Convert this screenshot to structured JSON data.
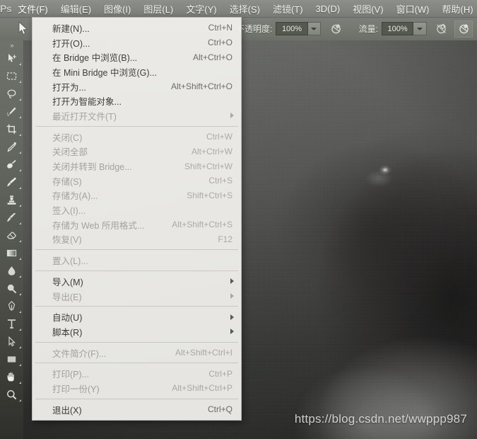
{
  "app": {
    "name": "Adobe Photoshop",
    "logo_text": "Ps"
  },
  "menubar": {
    "items": [
      {
        "label": "文件(F)",
        "name": "menu-file",
        "active": true
      },
      {
        "label": "编辑(E)",
        "name": "menu-edit",
        "active": false
      },
      {
        "label": "图像(I)",
        "name": "menu-image",
        "active": false
      },
      {
        "label": "图层(L)",
        "name": "menu-layer",
        "active": false
      },
      {
        "label": "文字(Y)",
        "name": "menu-type",
        "active": false
      },
      {
        "label": "选择(S)",
        "name": "menu-select",
        "active": false
      },
      {
        "label": "滤镜(T)",
        "name": "menu-filter",
        "active": false
      },
      {
        "label": "3D(D)",
        "name": "menu-3d",
        "active": false
      },
      {
        "label": "视图(V)",
        "name": "menu-view",
        "active": false
      },
      {
        "label": "窗口(W)",
        "name": "menu-window",
        "active": false
      },
      {
        "label": "帮助(H)",
        "name": "menu-help",
        "active": false
      }
    ]
  },
  "options_bar": {
    "opacity_label": "不透明度:",
    "opacity_value": "100%",
    "flow_label": "流量:",
    "flow_value": "100%",
    "airbrush_icon": "airbrush-icon",
    "pressure_opacity_icon": "pressure-opacity-icon",
    "pressure_size_icon": "pressure-size-icon"
  },
  "toolbar": {
    "collapse_glyph": "»",
    "tools": [
      {
        "name": "move-tool",
        "icon": "move-icon"
      },
      {
        "name": "marquee-tool",
        "icon": "rectangular-marquee-icon"
      },
      {
        "name": "lasso-tool",
        "icon": "lasso-icon"
      },
      {
        "name": "quick-selection-tool",
        "icon": "quick-selection-icon"
      },
      {
        "name": "crop-tool",
        "icon": "crop-icon"
      },
      {
        "name": "eyedropper-tool",
        "icon": "eyedropper-icon"
      },
      {
        "name": "healing-brush-tool",
        "icon": "healing-brush-icon"
      },
      {
        "name": "brush-tool",
        "icon": "brush-icon"
      },
      {
        "name": "clone-stamp-tool",
        "icon": "clone-stamp-icon"
      },
      {
        "name": "history-brush-tool",
        "icon": "history-brush-icon"
      },
      {
        "name": "eraser-tool",
        "icon": "eraser-icon"
      },
      {
        "name": "gradient-tool",
        "icon": "gradient-icon"
      },
      {
        "name": "blur-tool",
        "icon": "blur-droplet-icon"
      },
      {
        "name": "dodge-tool",
        "icon": "dodge-icon"
      },
      {
        "name": "pen-tool",
        "icon": "pen-icon"
      },
      {
        "name": "type-tool",
        "icon": "type-icon"
      },
      {
        "name": "path-selection-tool",
        "icon": "path-selection-icon"
      },
      {
        "name": "rectangle-tool",
        "icon": "rectangle-shape-icon"
      },
      {
        "name": "hand-tool",
        "icon": "hand-icon"
      },
      {
        "name": "zoom-tool",
        "icon": "magnifier-icon"
      }
    ]
  },
  "file_menu": {
    "title": "文件(F)",
    "groups": [
      {
        "items": [
          {
            "label": "新建(N)...",
            "accel": "Ctrl+N",
            "disabled": false,
            "submenu": false,
            "name": "file-new"
          },
          {
            "label": "打开(O)...",
            "accel": "Ctrl+O",
            "disabled": false,
            "submenu": false,
            "name": "file-open"
          },
          {
            "label": "在 Bridge 中浏览(B)...",
            "accel": "Alt+Ctrl+O",
            "disabled": false,
            "submenu": false,
            "name": "file-browse-bridge"
          },
          {
            "label": "在 Mini Bridge 中浏览(G)...",
            "accel": "",
            "disabled": false,
            "submenu": false,
            "name": "file-browse-mini-bridge"
          },
          {
            "label": "打开为...",
            "accel": "Alt+Shift+Ctrl+O",
            "disabled": false,
            "submenu": false,
            "name": "file-open-as"
          },
          {
            "label": "打开为智能对象...",
            "accel": "",
            "disabled": false,
            "submenu": false,
            "name": "file-open-as-smart-object"
          },
          {
            "label": "最近打开文件(T)",
            "accel": "",
            "disabled": true,
            "submenu": true,
            "name": "file-open-recent"
          }
        ]
      },
      {
        "items": [
          {
            "label": "关闭(C)",
            "accel": "Ctrl+W",
            "disabled": true,
            "submenu": false,
            "name": "file-close"
          },
          {
            "label": "关闭全部",
            "accel": "Alt+Ctrl+W",
            "disabled": true,
            "submenu": false,
            "name": "file-close-all"
          },
          {
            "label": "关闭并转到 Bridge...",
            "accel": "Shift+Ctrl+W",
            "disabled": true,
            "submenu": false,
            "name": "file-close-go-to-bridge"
          },
          {
            "label": "存储(S)",
            "accel": "Ctrl+S",
            "disabled": true,
            "submenu": false,
            "name": "file-save"
          },
          {
            "label": "存储为(A)...",
            "accel": "Shift+Ctrl+S",
            "disabled": true,
            "submenu": false,
            "name": "file-save-as"
          },
          {
            "label": "签入(I)...",
            "accel": "",
            "disabled": true,
            "submenu": false,
            "name": "file-check-in"
          },
          {
            "label": "存储为 Web 所用格式...",
            "accel": "Alt+Shift+Ctrl+S",
            "disabled": true,
            "submenu": false,
            "name": "file-save-for-web"
          },
          {
            "label": "恢复(V)",
            "accel": "F12",
            "disabled": true,
            "submenu": false,
            "name": "file-revert"
          }
        ]
      },
      {
        "items": [
          {
            "label": "置入(L)...",
            "accel": "",
            "disabled": true,
            "submenu": false,
            "name": "file-place"
          }
        ]
      },
      {
        "items": [
          {
            "label": "导入(M)",
            "accel": "",
            "disabled": false,
            "submenu": true,
            "name": "file-import"
          },
          {
            "label": "导出(E)",
            "accel": "",
            "disabled": true,
            "submenu": true,
            "name": "file-export"
          }
        ]
      },
      {
        "items": [
          {
            "label": "自动(U)",
            "accel": "",
            "disabled": false,
            "submenu": true,
            "name": "file-automate"
          },
          {
            "label": "脚本(R)",
            "accel": "",
            "disabled": false,
            "submenu": true,
            "name": "file-scripts"
          }
        ]
      },
      {
        "items": [
          {
            "label": "文件简介(F)...",
            "accel": "Alt+Shift+Ctrl+I",
            "disabled": true,
            "submenu": false,
            "name": "file-file-info"
          }
        ]
      },
      {
        "items": [
          {
            "label": "打印(P)...",
            "accel": "Ctrl+P",
            "disabled": true,
            "submenu": false,
            "name": "file-print"
          },
          {
            "label": "打印一份(Y)",
            "accel": "Alt+Shift+Ctrl+P",
            "disabled": true,
            "submenu": false,
            "name": "file-print-one-copy"
          }
        ]
      },
      {
        "items": [
          {
            "label": "退出(X)",
            "accel": "Ctrl+Q",
            "disabled": false,
            "submenu": false,
            "name": "file-exit"
          }
        ]
      }
    ]
  },
  "watermark": {
    "text": "https://blog.csdn.net/wwppp987"
  },
  "colors": {
    "menubar_bg": "#83867f",
    "optionsbar_bg": "#74776f",
    "toolbar_bg": "#63665f",
    "menu_bg": "#f4f3ef",
    "menu_text": "#3b3b38",
    "menu_text_disabled": "#a9a8a4",
    "canvas_bg": "#43443e"
  }
}
